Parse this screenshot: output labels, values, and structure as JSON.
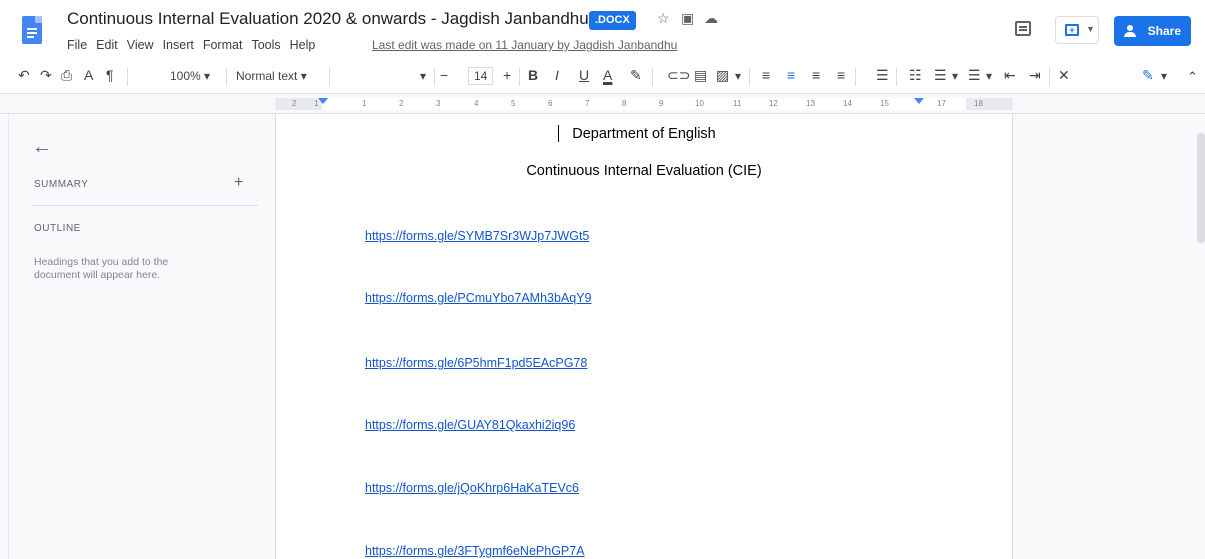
{
  "window": {
    "title": "Continuous Internal Evaluation 2020 & onwards - Jagdish Janbandhu",
    "badge": ".DOCX",
    "title_icons": [
      "star-icon",
      "move-to-folder-icon",
      "cloud-status-icon"
    ],
    "share_label": "Share"
  },
  "menu": {
    "items": [
      "File",
      "Edit",
      "View",
      "Insert",
      "Format",
      "Tools",
      "Help"
    ],
    "last_edit": "Last edit was made on 11 January by Jagdish Janbandhu"
  },
  "toolbar": {
    "zoom": "100%",
    "style": "Normal text",
    "font_size": "14",
    "minus": "−",
    "plus": "+",
    "bold": "B",
    "italic": "I",
    "underline": "U",
    "text_color": "A"
  },
  "ruler": {
    "numbers": [
      "2",
      "1",
      "1",
      "2",
      "3",
      "4",
      "5",
      "6",
      "7",
      "8",
      "9",
      "10",
      "11",
      "12",
      "13",
      "14",
      "15",
      "16",
      "17",
      "18"
    ]
  },
  "outline_panel": {
    "summary_label": "SUMMARY",
    "add_label": "+",
    "outline_label": "OUTLINE",
    "hint": "Headings that you add to the document will appear here."
  },
  "document": {
    "heading": "Department of English",
    "subheading": "Continuous Internal Evaluation (CIE)",
    "links": [
      "https://forms.gle/SYMB7Sr3WJp7JWGt5",
      "https://forms.gle/PCmuYbo7AMh3bAqY9",
      "https://forms.gle/6P5hmF1pd5EAcPG78",
      "https://forms.gle/GUAY81Qkaxhi2iq96",
      "https://forms.gle/jQoKhrp6HaKaTEVc6",
      "https://forms.gle/3FTygmf6eNePhGP7A"
    ]
  },
  "colors": {
    "accent": "#1a73e8",
    "link": "#1155cc",
    "doc_icon": "#4285f4"
  }
}
